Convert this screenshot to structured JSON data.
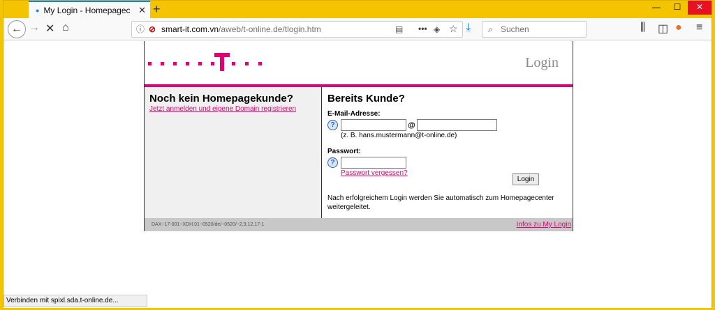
{
  "browser": {
    "tab_title": "My Login - Homepagecenter L",
    "url_host": "smart-it.com.vn",
    "url_path": "/aweb/t-online.de/tlogin.htm",
    "search_placeholder": "Suchen",
    "status_text": "Verbinden mit spixl.sda.t-online.de..."
  },
  "header": {
    "login_title": "Login"
  },
  "left": {
    "heading": "Noch kein Homepagekunde?",
    "register_link": "Jetzt anmelden und eigene Domain registrieren"
  },
  "right": {
    "heading": "Bereits Kunde?",
    "email_label": "E-Mail-Adresse:",
    "email_value": "",
    "domain_value": "",
    "at_sign": "@",
    "email_hint": "(z. B. hans.mustermann@t-online.de)",
    "password_label": "Passwort:",
    "password_value": "",
    "forgot_link": "Passwort vergessen?",
    "login_button": "Login",
    "notice": "Nach erfolgreichem Login werden Sie automatisch zum Homepagecenter weitergeleitet."
  },
  "footer": {
    "code": "DAX~17-001~XDH.01~0520/de/~0520/~2.9.12.17-1",
    "info_link": "Infos zu My Login"
  },
  "colors": {
    "brand": "#e20074",
    "window_frame": "#f5c400"
  }
}
